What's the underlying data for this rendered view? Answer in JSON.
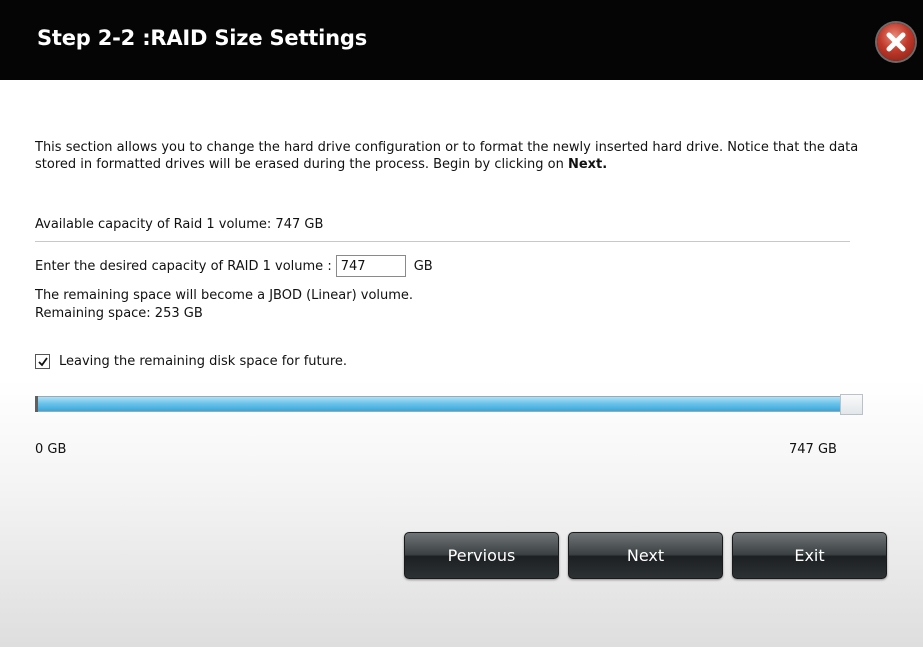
{
  "dialog": {
    "title": "Step 2-2 :RAID Size Settings",
    "close_icon": "close-icon"
  },
  "description": {
    "text": "This section allows you to change the hard drive configuration or to format the newly inserted hard drive. Notice that the data stored in formatted drives will be erased during the process. Begin by clicking on ",
    "emphasis": "Next."
  },
  "capacity": {
    "available_label": "Available capacity of Raid 1 volume: 747 GB",
    "desired_label": "Enter the desired capacity of RAID 1  volume :",
    "desired_value": "747",
    "unit": "GB",
    "remaining_note": "The remaining space will become a JBOD (Linear) volume.",
    "remaining_space": "Remaining space: 253 GB"
  },
  "leave_option": {
    "checked": true,
    "label": "Leaving the remaining disk space for future."
  },
  "slider": {
    "min_label": "0 GB",
    "max_label": "747 GB",
    "value_fraction": 1.0,
    "fill_color": "#4ab3e3"
  },
  "buttons": {
    "previous": "Pervious",
    "next": "Next",
    "exit": "Exit"
  }
}
